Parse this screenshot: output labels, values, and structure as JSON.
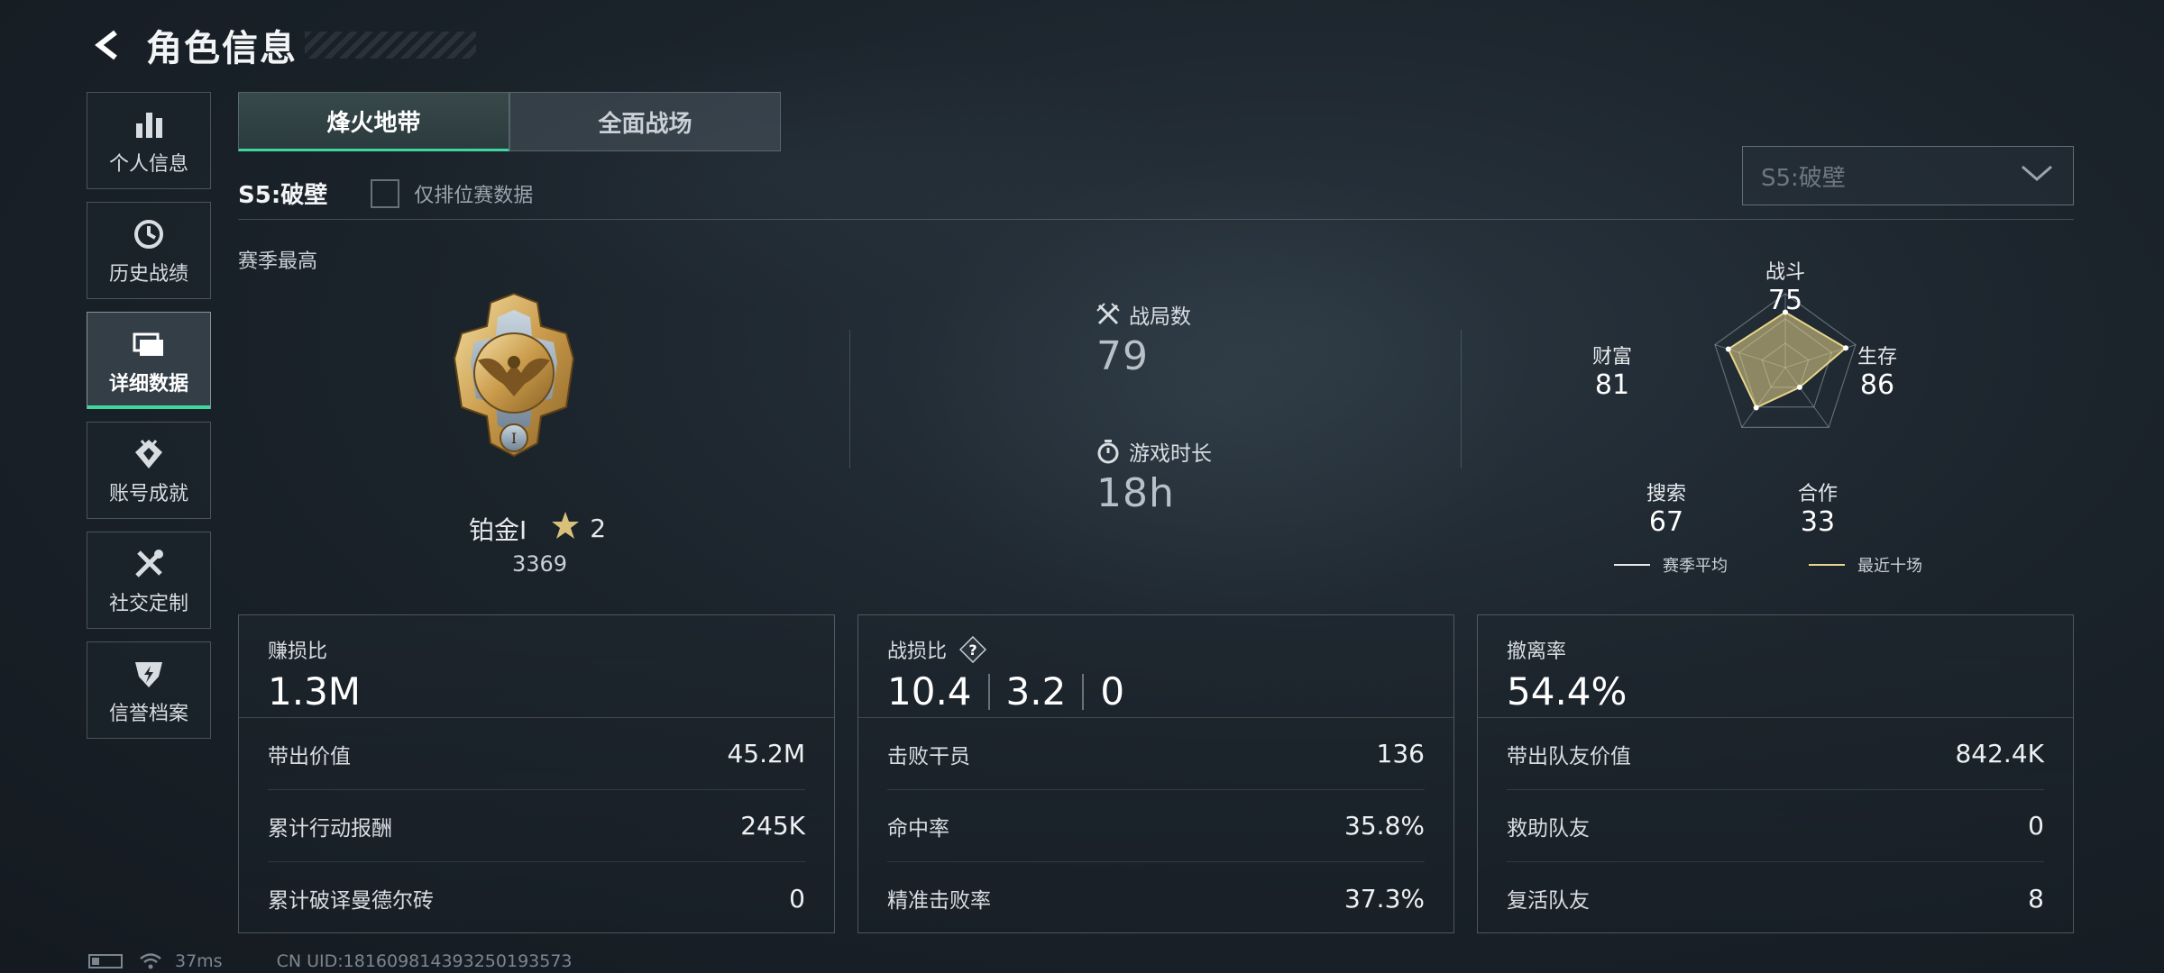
{
  "header": {
    "title": "角色信息"
  },
  "sidebar": {
    "items": [
      {
        "label": "个人信息",
        "icon": "bar-chart-icon",
        "active": false
      },
      {
        "label": "历史战绩",
        "icon": "clock-history-icon",
        "active": false
      },
      {
        "label": "详细数据",
        "icon": "folders-icon",
        "active": true
      },
      {
        "label": "账号成就",
        "icon": "achievement-icon",
        "active": false
      },
      {
        "label": "社交定制",
        "icon": "tools-icon",
        "active": false
      },
      {
        "label": "信誉档案",
        "icon": "reputation-shield-icon",
        "active": false
      }
    ]
  },
  "tabs": [
    {
      "label": "烽火地带",
      "active": true
    },
    {
      "label": "全面战场",
      "active": false
    }
  ],
  "season": {
    "label": "S5:破壁",
    "ranked_only_label": "仅排位赛数据",
    "ranked_only_checked": false,
    "select_value": "S5:破壁"
  },
  "section_title": "赛季最高",
  "rank": {
    "name": "铂金Ⅰ",
    "stars": "2",
    "score": "3369"
  },
  "stats": {
    "matches_label": "战局数",
    "matches_value": "79",
    "playtime_label": "游戏时长",
    "playtime_value": "18h"
  },
  "radar": {
    "axes": [
      {
        "name": "战斗",
        "value": 75
      },
      {
        "name": "生存",
        "value": 86
      },
      {
        "name": "合作",
        "value": 33
      },
      {
        "name": "搜索",
        "value": 67
      },
      {
        "name": "财富",
        "value": 81
      }
    ],
    "values_text": [
      "75",
      "86",
      "33",
      "67",
      "81"
    ],
    "legend": [
      {
        "label": "赛季平均",
        "color": "#e6e9ec"
      },
      {
        "label": "最近十场",
        "color": "#e8d48a"
      }
    ]
  },
  "cards": {
    "profit": {
      "label": "赚损比",
      "value": "1.3M",
      "rows": [
        {
          "label": "带出价值",
          "value": "45.2M"
        },
        {
          "label": "累计行动报酬",
          "value": "245K"
        },
        {
          "label": "累计破译曼德尔砖",
          "value": "0"
        }
      ]
    },
    "kd": {
      "label": "战损比",
      "values": [
        "10.4",
        "3.2",
        "0"
      ],
      "rows": [
        {
          "label": "击败干员",
          "value": "136"
        },
        {
          "label": "命中率",
          "value": "35.8%"
        },
        {
          "label": "精准击败率",
          "value": "37.3%"
        }
      ]
    },
    "extract": {
      "label": "撤离率",
      "value": "54.4%",
      "rows": [
        {
          "label": "带出队友价值",
          "value": "842.4K"
        },
        {
          "label": "救助队友",
          "value": "0"
        },
        {
          "label": "复活队友",
          "value": "8"
        }
      ]
    }
  },
  "footer": {
    "ping": "37ms",
    "uid": "CN UID:1816098143932501935​73"
  },
  "colors": {
    "accent": "#3fd6a0",
    "gold": "#e8d48a"
  }
}
